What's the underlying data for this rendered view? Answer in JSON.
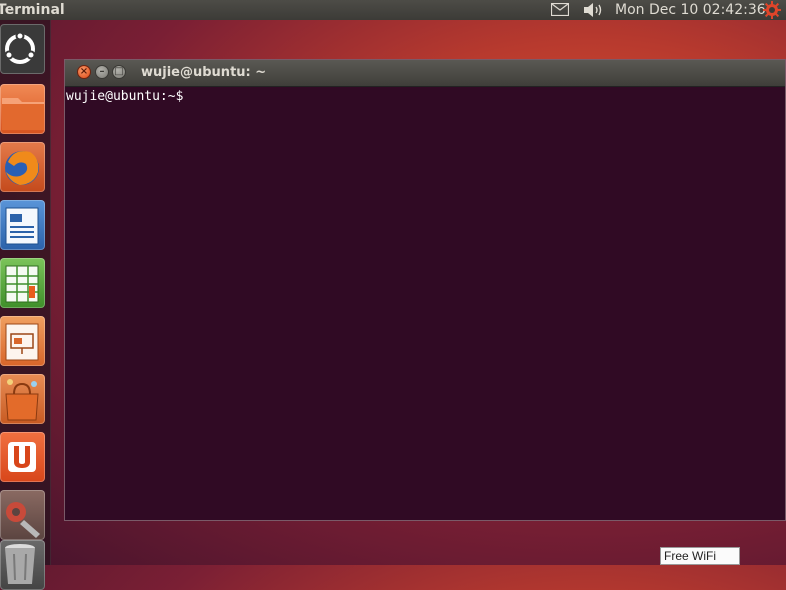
{
  "top_panel": {
    "app_title": "Terminal",
    "clock": "Mon Dec 10 02:42:36",
    "icons": [
      "mail-icon",
      "sound-icon",
      "session-gear-icon"
    ]
  },
  "launcher": {
    "items": [
      "dash-home",
      "files",
      "firefox",
      "writer",
      "calc",
      "impress",
      "software-center",
      "ubuntu-one",
      "system-settings",
      "trash"
    ]
  },
  "terminal": {
    "title": "wujie@ubuntu: ~",
    "prompt": "wujie@ubuntu:~$",
    "buttons": {
      "close": "×",
      "minimize": "–",
      "maximize": "□"
    },
    "background_color": "#300a24"
  },
  "wifi_label": "Free WiFi"
}
